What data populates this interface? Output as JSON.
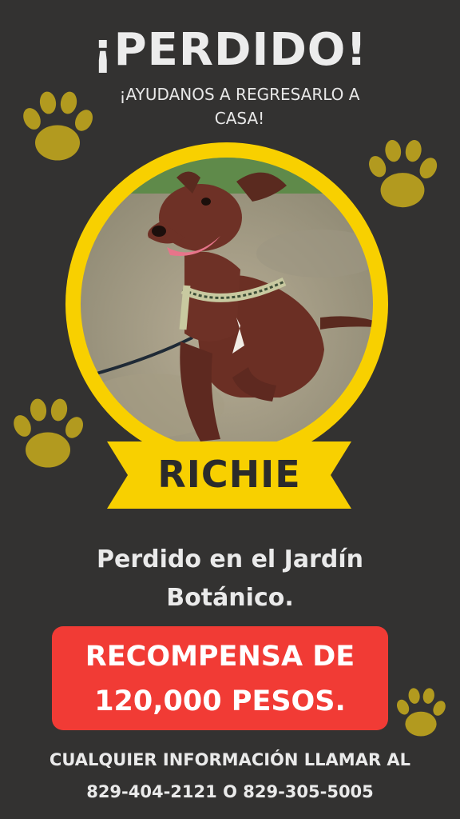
{
  "title": "¡PERDIDO!",
  "subtitle": "¡AYUDANOS A REGRESARLO A CASA!",
  "pet_name": "RICHIE",
  "location": "Perdido en el Jardín Botánico.",
  "reward_line1": "RECOMPENSA DE",
  "reward_line2": "120,000 PESOS.",
  "contact_line1": "CUALQUIER INFORMACIÓN LLAMAR AL",
  "contact_line2": "829-404-2121 O 829-305-5005",
  "colors": {
    "background": "#333231",
    "accent_yellow": "#f8d000",
    "paw_gold": "#b29a1f",
    "reward_red": "#f13b35"
  },
  "icons": [
    "paw-icon"
  ]
}
